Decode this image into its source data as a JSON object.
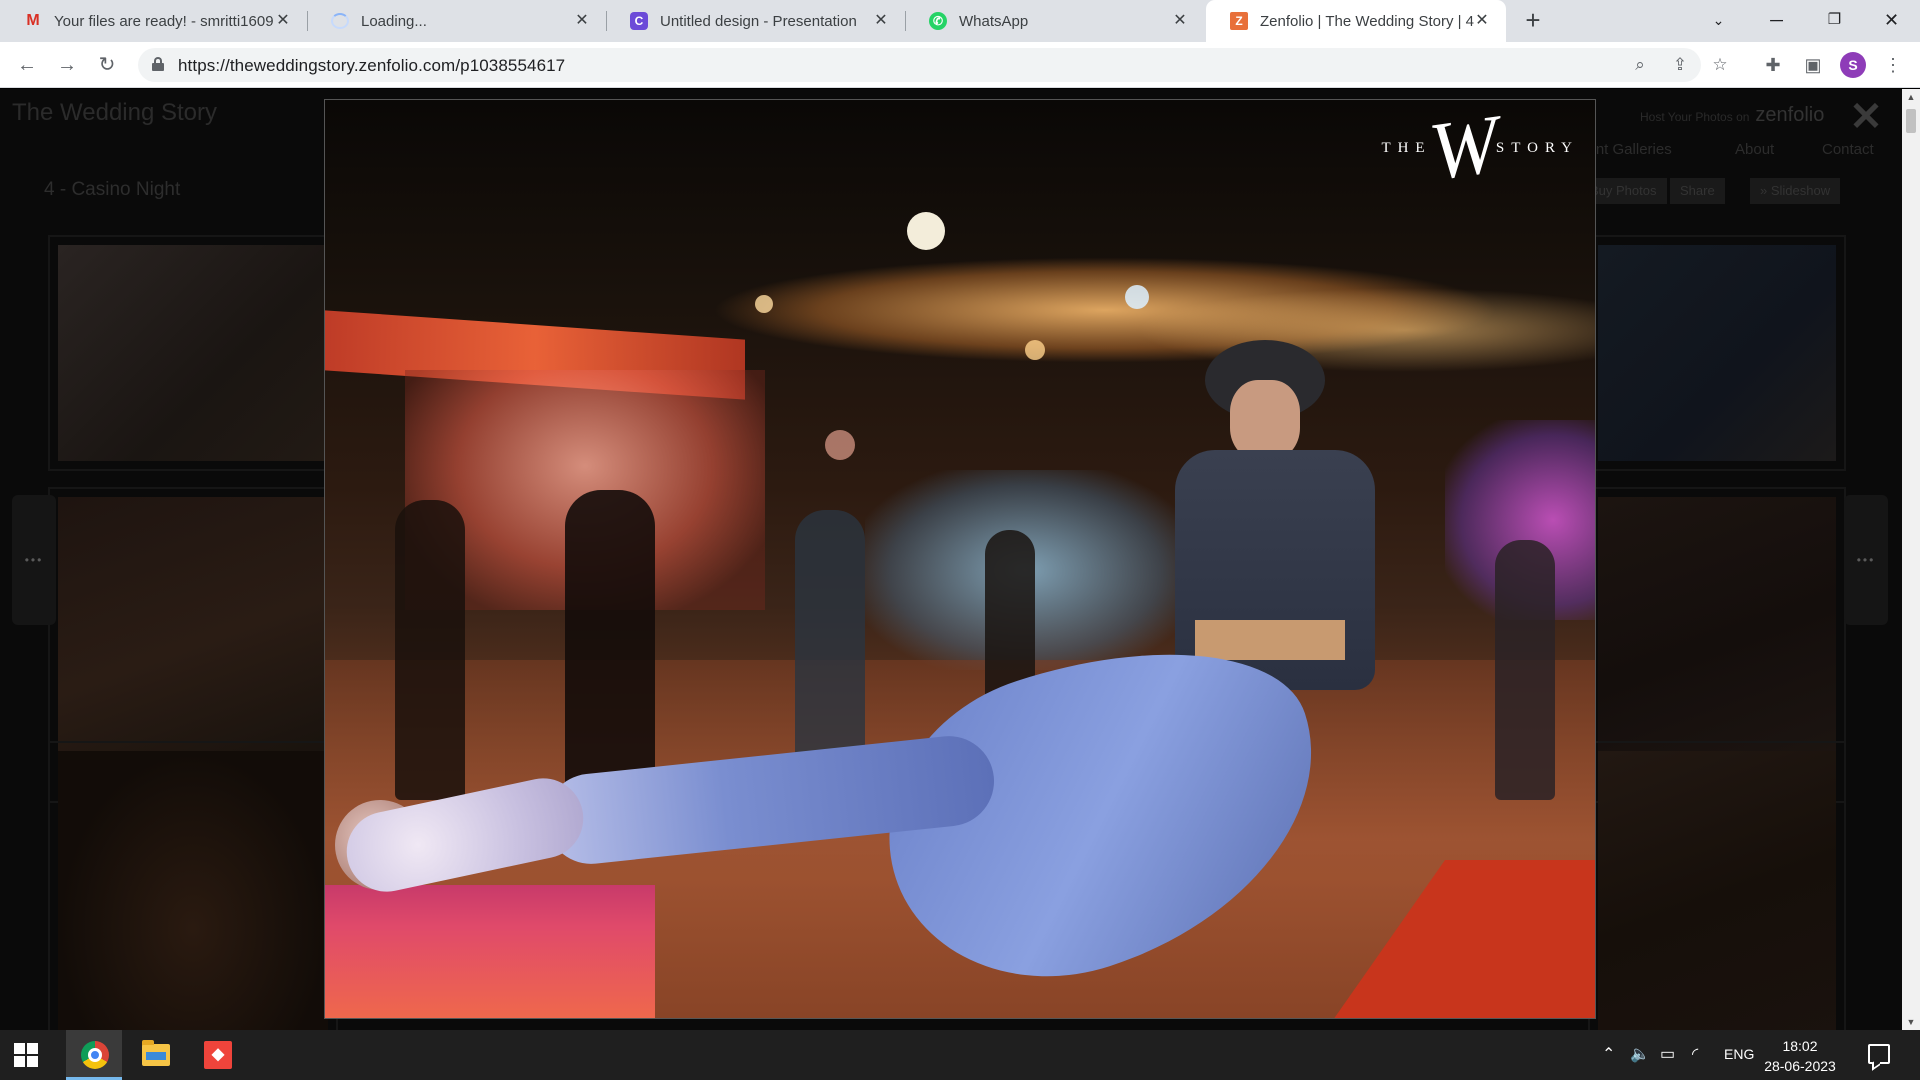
{
  "browser": {
    "tabs": [
      {
        "title": "Your files are ready! - smritti1609",
        "icon": "gmail-icon",
        "favicon_glyph": "M"
      },
      {
        "title": "Loading...",
        "icon": "loading-spinner-icon",
        "favicon_glyph": ""
      },
      {
        "title": "Untitled design - Presentation",
        "icon": "canva-icon",
        "favicon_glyph": "C"
      },
      {
        "title": "WhatsApp",
        "icon": "whatsapp-icon",
        "favicon_glyph": "✆"
      },
      {
        "title": "Zenfolio | The Wedding Story | 4",
        "icon": "zenfolio-icon",
        "favicon_glyph": "Z"
      }
    ],
    "active_tab_index": 4,
    "new_tab_glyph": "+",
    "url": "https://theweddingstory.zenfolio.com/p1038554617",
    "profile_initial": "S"
  },
  "site": {
    "title": "The Wedding Story",
    "promo_text": "Host Your Photos on",
    "promo_brand": "zenfolio",
    "nav": [
      "Client Galleries",
      "About",
      "Contact"
    ],
    "gallery_title": "4 - Casino Night",
    "buttons": [
      "Buy Photos",
      "Share",
      "» Slideshow"
    ]
  },
  "lightbox": {
    "watermark_prefix": "THE",
    "watermark_letter": "W",
    "watermark_suffix": "STORY",
    "close_glyph": "✕",
    "prev_glyph": "•••",
    "next_glyph": "•••"
  },
  "taskbar": {
    "apps": [
      "chrome-icon",
      "file-explorer-icon",
      "anydesk-icon"
    ],
    "language": "ENG",
    "time": "18:02",
    "date": "28-06-2023"
  },
  "colors": {
    "page_bg": "#0a0a0a",
    "taskbar_bg": "#1f1f1f",
    "tabstrip_bg": "#dee1e6",
    "accent_zenfolio": "#e8703a"
  }
}
